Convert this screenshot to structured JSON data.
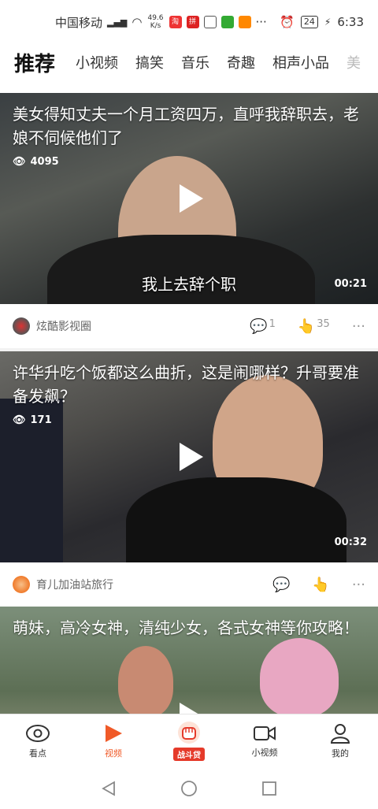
{
  "status": {
    "carrier": "中国移动",
    "network": "4G",
    "speed_value": "49.6",
    "speed_unit": "K/s",
    "battery": "24",
    "time": "6:33"
  },
  "tabs": {
    "main": "推荐",
    "items": [
      "小视频",
      "搞笑",
      "音乐",
      "奇趣",
      "相声小品",
      "美"
    ]
  },
  "feed": [
    {
      "title": "美女得知丈夫一个月工资四万，直呼我辞职去，老娘不伺候他们了",
      "views": "4095",
      "subtitle": "我上去辞个职",
      "duration": "00:21",
      "author": "炫酷影视圈",
      "comments": "1",
      "likes": "35"
    },
    {
      "title": "许华升吃个饭都这么曲折，这是闹哪样？升哥要准备发飙？",
      "views": "171",
      "duration": "00:32",
      "author": "育儿加油站旅行"
    },
    {
      "title": "萌妹，高冷女神，清纯少女，各式女神等你攻略！"
    }
  ],
  "bottom_nav": {
    "items": [
      {
        "label": "看点",
        "icon": "eye-icon"
      },
      {
        "label": "视频",
        "icon": "play-icon"
      },
      {
        "label": "战斗贷",
        "icon": "fist-icon"
      },
      {
        "label": "小视频",
        "icon": "camera-icon"
      },
      {
        "label": "我的",
        "icon": "person-icon"
      }
    ]
  },
  "colors": {
    "accent": "#f05a28",
    "badge": "#e53a2a"
  }
}
